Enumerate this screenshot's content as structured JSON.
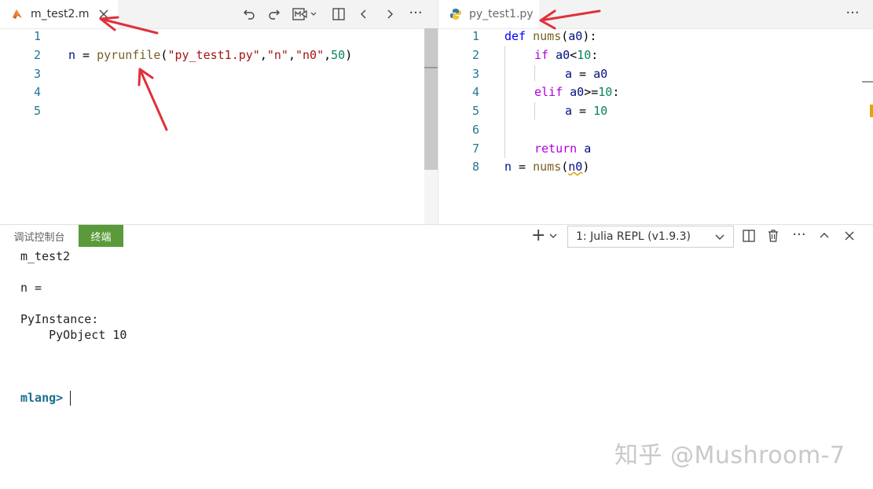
{
  "left_editor": {
    "tab_label": "m_test2.m",
    "line_numbers": [
      "1",
      "2",
      "3",
      "4",
      "5"
    ],
    "line2": {
      "var": "n",
      "op": " = ",
      "func": "pyrunfile",
      "open": "(",
      "arg1": "\"py_test1.py\"",
      "c1": ",",
      "arg2": "\"n\"",
      "c2": ",",
      "arg3": "\"n0\"",
      "c3": ",",
      "arg4": "50",
      "close": ")"
    }
  },
  "right_editor": {
    "tab_label": "py_test1.py",
    "more_label": "···",
    "line_numbers": [
      "1",
      "2",
      "3",
      "4",
      "5",
      "6",
      "7",
      "8"
    ],
    "code": {
      "l1_kw": "def",
      "l1_fn": "nums",
      "l1_rest_open": "(",
      "l1_param": "a0",
      "l1_rest_close": "):",
      "l2_kw": "if",
      "l2_cond_var": "a0",
      "l2_cond_op": "<",
      "l2_num": "10",
      "l2_colon": ":",
      "l3_var": "a",
      "l3_op": " = ",
      "l3_val": "a0",
      "l4_kw": "elif",
      "l4_var": "a0",
      "l4_op": ">=",
      "l4_num": "10",
      "l4_colon": ":",
      "l5_var": "a",
      "l5_op": " = ",
      "l5_num": "10",
      "l7_kw": "return",
      "l7_var": "a",
      "l8_var": "n",
      "l8_op": " = ",
      "l8_fn": "nums",
      "l8_open": "(",
      "l8_arg": "n0",
      "l8_close": ")"
    }
  },
  "toolbar": {
    "more_label": "···"
  },
  "panel": {
    "tab_debug": "调试控制台",
    "tab_terminal": "终端",
    "add_label": "+",
    "terminal_select": "1: Julia REPL (v1.9.3)",
    "more_label": "···"
  },
  "terminal": {
    "lines": [
      "m_test2",
      "n =",
      "PyInstance:",
      "    PyObject 10"
    ],
    "prompt": "mlang>"
  },
  "watermark": "知乎 @Mushroom-7",
  "colors": {
    "arrow": "#e0303a",
    "terminal_tab": "#5a9a3b",
    "line_number": "#237893"
  }
}
